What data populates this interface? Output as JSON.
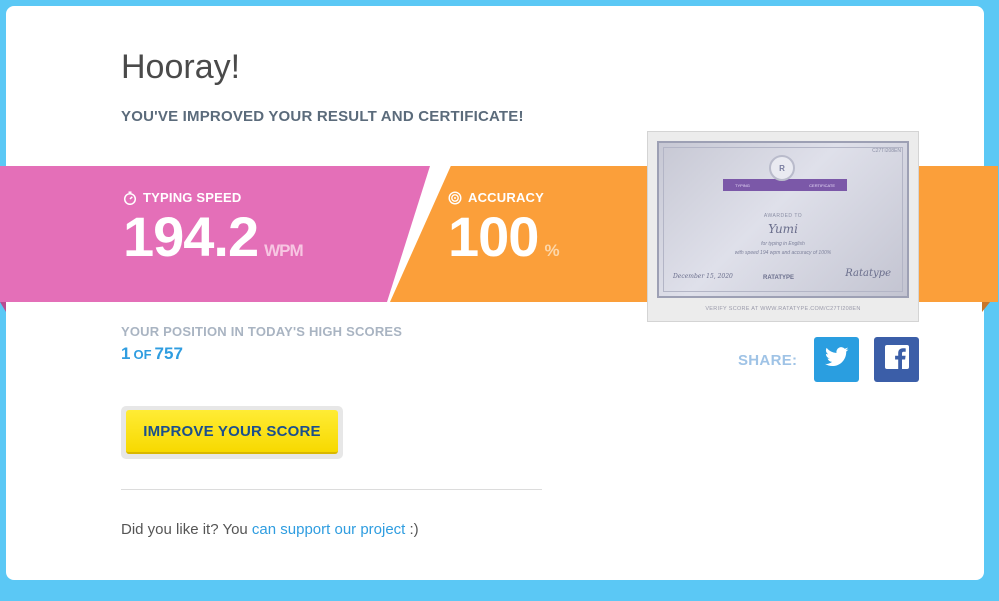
{
  "header": {
    "title": "Hooray!",
    "subtitle": "YOU'VE IMPROVED YOUR RESULT AND CERTIFICATE!"
  },
  "stats": {
    "speed_label": "TYPING SPEED",
    "speed_value": "194.2",
    "speed_unit": "WPM",
    "accuracy_label": "ACCURACY",
    "accuracy_value": "100",
    "accuracy_unit": "%"
  },
  "certificate": {
    "id": "C27TI208EN",
    "ribbon_left": "TYPING",
    "ribbon_right": "CERTIFICATE",
    "badge": "R",
    "awarded_to": "AWARDED TO",
    "name": "Yumi",
    "line1": "for typing in English",
    "line2": "with speed 194 wpm and accuracy of 100%",
    "date": "December 15, 2020",
    "brand": "RATATYPE",
    "signature": "Ratatype",
    "verify": "VERIFY SCORE AT WWW.RATATYPE.COM/C27TI208EN"
  },
  "position": {
    "label": "YOUR POSITION IN TODAY'S HIGH SCORES",
    "rank": "1",
    "of": "OF",
    "total": "757"
  },
  "share": {
    "label": "SHARE:"
  },
  "actions": {
    "improve_label": "IMPROVE YOUR SCORE"
  },
  "footer": {
    "support_prefix": "Did you like it? You ",
    "support_link": "can support our project",
    "support_suffix": " :)"
  },
  "colors": {
    "background": "#5bc8f5",
    "speed_ribbon": "#e46fb8",
    "accuracy_ribbon": "#fb9f3a",
    "button": "#ffe01a",
    "twitter": "#2a9ee0",
    "facebook": "#3b5ea8"
  }
}
